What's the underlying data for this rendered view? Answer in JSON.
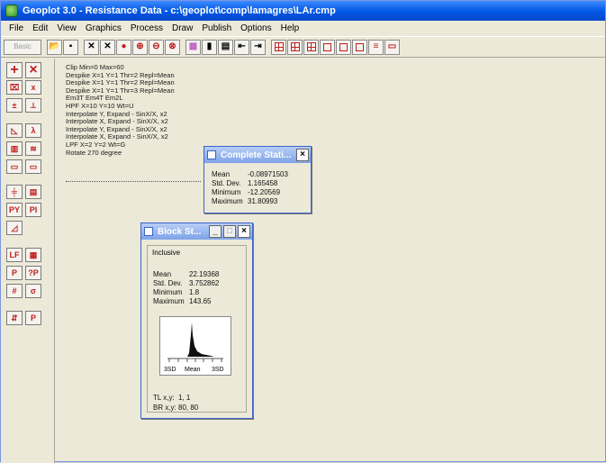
{
  "window": {
    "title": "Geoplot 3.0 - Resistance Data - c:\\geoplot\\comp\\lamagres\\LAr.cmp"
  },
  "menu": [
    "File",
    "Edit",
    "View",
    "Graphics",
    "Process",
    "Draw",
    "Publish",
    "Options",
    "Help"
  ],
  "toolbar": {
    "first_button_label": "Basic",
    "buttons": [
      "open-icon",
      "save-icon",
      "cross-icon",
      "cross-icon",
      "fish-icon",
      "zoom-in-icon",
      "zoom-out-icon",
      "zoom-icon",
      "palette-icon",
      "bars-icon",
      "grid-icon",
      "arrow-left-icon",
      "arrow-right-icon",
      "view-icon",
      "view-icon",
      "view-icon",
      "view-icon",
      "view-icon",
      "view-icon",
      "view-icon",
      "view-icon"
    ]
  },
  "palette": [
    "+",
    "×",
    "⌧",
    "x",
    "±",
    "⟂",
    "◺",
    "λ",
    "▥",
    "≋",
    "▭",
    "▭",
    "╪",
    "▤",
    "PY",
    "PI",
    "◿",
    "LF",
    "▦",
    "P",
    "?P",
    "#",
    "σ",
    "⇵",
    "P"
  ],
  "log": {
    "lines": [
      "Clip Min=0 Max=60",
      "Despike X=1 Y=1 Thr=2 Repl=Mean",
      "Despike X=1 Y=1 Thr=2 Repl=Mean",
      "Despike X=1 Y=1 Thr=3 Repl=Mean",
      "Em3T Em4T Em2L",
      "HPF X=10 Y=10 Wt=U",
      "Interpolate Y, Expand - SinX/X, x2",
      "Interpolate X, Expand - SinX/X, x2",
      "Interpolate Y, Expand - SinX/X, x2",
      "Interpolate X, Expand - SinX/X, x2",
      "LPF X=2 Y=2 Wt=G",
      "Rotate 270 degree"
    ]
  },
  "complete_stats": {
    "title": "Complete Stati...",
    "close": "×",
    "rows": [
      {
        "label": "Mean",
        "value": "-0.08971503"
      },
      {
        "label": "Std. Dev.",
        "value": "1.165458"
      },
      {
        "label": "Minimum",
        "value": "-12.20569"
      },
      {
        "label": "Maximum",
        "value": "31.80993"
      }
    ]
  },
  "block_stats": {
    "title": "Block St...",
    "min_btn": "_",
    "max_btn": "□",
    "close": "×",
    "group_label": "Inclusive",
    "rows": [
      {
        "label": "Mean",
        "value": "22.19368"
      },
      {
        "label": "Std. Dev.",
        "value": "3.752862"
      },
      {
        "label": "Minimum",
        "value": "1.8"
      },
      {
        "label": "Maximum",
        "value": "143.65"
      }
    ],
    "histogram_labels": {
      "left": "3SD",
      "center": "Mean",
      "right": "3SD"
    },
    "tl_label": "TL x,y:",
    "tl_value": "1, 1",
    "br_label": "BR x,y:",
    "br_value": "80, 80"
  }
}
